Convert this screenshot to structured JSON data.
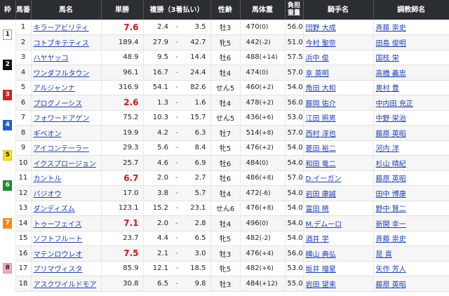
{
  "headers": {
    "waku": "枠",
    "umaban": "馬番",
    "name": "馬名",
    "odds": "単勝",
    "place": "複勝（3着払い）",
    "sexage": "性齢",
    "weight": "馬体重",
    "kinryo": "負担\n重量",
    "jockey": "騎手名",
    "trainer": "調教師名"
  },
  "waku_groups": [
    {
      "label": "1",
      "bg": "#ffffff",
      "fg": "#222222",
      "border": "#999999",
      "rows": 2
    },
    {
      "label": "2",
      "bg": "#111111",
      "fg": "#ffffff",
      "border": "#111111",
      "rows": 2
    },
    {
      "label": "3",
      "bg": "#d32020",
      "fg": "#ffffff",
      "border": "#d32020",
      "rows": 2
    },
    {
      "label": "4",
      "bg": "#1e5fd0",
      "fg": "#ffffff",
      "border": "#1e5fd0",
      "rows": 2
    },
    {
      "label": "5",
      "bg": "#f5e11a",
      "fg": "#222222",
      "border": "#e0c800",
      "rows": 2
    },
    {
      "label": "6",
      "bg": "#1e8a2e",
      "fg": "#ffffff",
      "border": "#1e8a2e",
      "rows": 2
    },
    {
      "label": "7",
      "bg": "#f08a1c",
      "fg": "#ffffff",
      "border": "#f08a1c",
      "rows": 3
    },
    {
      "label": "8",
      "bg": "#f5a8c0",
      "fg": "#222222",
      "border": "#e890ab",
      "rows": 3
    }
  ],
  "horses": [
    {
      "num": "1",
      "name": "キラーアビリティ",
      "odds": "7.6",
      "fav": true,
      "p1": "2.4",
      "p2": "3.5",
      "sexage": "牡3",
      "weight": "470",
      "diff": "(0)",
      "kinryo": "56.0",
      "jockey": "団野 大成",
      "trainer": "斉藤 崇史"
    },
    {
      "num": "2",
      "name": "コトブキテティス",
      "odds": "189.4",
      "fav": false,
      "p1": "27.9",
      "p2": "42.7",
      "sexage": "牝5",
      "weight": "442",
      "diff": "(-2)",
      "kinryo": "51.0",
      "jockey": "今村 聖奈",
      "trainer": "田島 俊明"
    },
    {
      "num": "3",
      "name": "ハヤヤッコ",
      "odds": "48.9",
      "fav": false,
      "p1": "9.5",
      "p2": "14.4",
      "sexage": "牡6",
      "weight": "488",
      "diff": "(+14)",
      "kinryo": "57.5",
      "jockey": "浜中 俊",
      "trainer": "国枝 栄"
    },
    {
      "num": "4",
      "name": "ワンダフルタウン",
      "odds": "96.1",
      "fav": false,
      "p1": "16.7",
      "p2": "24.4",
      "sexage": "牡4",
      "weight": "474",
      "diff": "(0)",
      "kinryo": "57.0",
      "jockey": "幸 英明",
      "trainer": "高橋 義忠"
    },
    {
      "num": "5",
      "name": "アルジャンナ",
      "odds": "316.9",
      "fav": false,
      "p1": "54.1",
      "p2": "82.6",
      "sexage": "せん5",
      "weight": "460",
      "diff": "(+2)",
      "kinryo": "54.0",
      "jockey": "角田 大和",
      "trainer": "奥村 豊"
    },
    {
      "num": "6",
      "name": "プログノーシス",
      "odds": "2.6",
      "fav": true,
      "p1": "1.3",
      "p2": "1.6",
      "sexage": "牡4",
      "weight": "478",
      "diff": "(+2)",
      "kinryo": "56.0",
      "jockey": "藤岡 佑介",
      "trainer": "中内田 充正"
    },
    {
      "num": "7",
      "name": "フォワードアゲン",
      "odds": "75.2",
      "fav": false,
      "p1": "10.3",
      "p2": "15.7",
      "sexage": "せん5",
      "weight": "436",
      "diff": "(+6)",
      "kinryo": "53.0",
      "jockey": "江田 照男",
      "trainer": "中野 栄治"
    },
    {
      "num": "8",
      "name": "ギベオン",
      "odds": "19.9",
      "fav": false,
      "p1": "4.2",
      "p2": "6.3",
      "sexage": "牡7",
      "weight": "514",
      "diff": "(+8)",
      "kinryo": "57.0",
      "jockey": "西村 淳也",
      "trainer": "藤原 英昭"
    },
    {
      "num": "9",
      "name": "アイコンテーラー",
      "odds": "29.3",
      "fav": false,
      "p1": "5.6",
      "p2": "8.4",
      "sexage": "牝5",
      "weight": "476",
      "diff": "(+2)",
      "kinryo": "54.0",
      "jockey": "菱田 裕二",
      "trainer": "河内 洋"
    },
    {
      "num": "10",
      "name": "イクスプロージョン",
      "odds": "25.7",
      "fav": false,
      "p1": "4.6",
      "p2": "6.9",
      "sexage": "牡6",
      "weight": "484",
      "diff": "(0)",
      "kinryo": "54.0",
      "jockey": "和田 竜二",
      "trainer": "杉山 晴紀"
    },
    {
      "num": "11",
      "name": "カントル",
      "odds": "6.7",
      "fav": true,
      "p1": "2.0",
      "p2": "2.7",
      "sexage": "牡6",
      "weight": "486",
      "diff": "(+8)",
      "kinryo": "57.0",
      "jockey": "D.イーガン",
      "trainer": "藤原 英昭"
    },
    {
      "num": "12",
      "name": "バジオウ",
      "odds": "17.0",
      "fav": false,
      "p1": "3.8",
      "p2": "5.7",
      "sexage": "牡4",
      "weight": "472",
      "diff": "(-6)",
      "kinryo": "54.0",
      "jockey": "岩田 康誠",
      "trainer": "田中 博康"
    },
    {
      "num": "13",
      "name": "ダンディズム",
      "odds": "123.1",
      "fav": false,
      "p1": "15.2",
      "p2": "23.1",
      "sexage": "せん6",
      "weight": "476",
      "diff": "(+8)",
      "kinryo": "54.0",
      "jockey": "富田 暁",
      "trainer": "野中 賢二"
    },
    {
      "num": "14",
      "name": "トゥーフェイス",
      "odds": "7.1",
      "fav": true,
      "p1": "2.0",
      "p2": "2.8",
      "sexage": "牡4",
      "weight": "496",
      "diff": "(0)",
      "kinryo": "54.0",
      "jockey": "M.デムーロ",
      "trainer": "新開 幸一"
    },
    {
      "num": "15",
      "name": "ソフトフルート",
      "odds": "23.7",
      "fav": false,
      "p1": "4.4",
      "p2": "6.5",
      "sexage": "牝5",
      "weight": "482",
      "diff": "(-2)",
      "kinryo": "54.0",
      "jockey": "酒井 学",
      "trainer": "斉藤 崇史"
    },
    {
      "num": "16",
      "name": "マテンロウレオ",
      "odds": "7.5",
      "fav": true,
      "p1": "2.1",
      "p2": "3.0",
      "sexage": "牡3",
      "weight": "476",
      "diff": "(+4)",
      "kinryo": "56.0",
      "jockey": "横山 典弘",
      "trainer": "昆 貢"
    },
    {
      "num": "17",
      "name": "プリマヴィスタ",
      "odds": "85.9",
      "fav": false,
      "p1": "12.1",
      "p2": "18.5",
      "sexage": "牝5",
      "weight": "482",
      "diff": "(+6)",
      "kinryo": "53.0",
      "jockey": "坂井 瑠星",
      "trainer": "矢作 芳人"
    },
    {
      "num": "18",
      "name": "アスクワイルドモア",
      "odds": "30.8",
      "fav": false,
      "p1": "6.5",
      "p2": "9.8",
      "sexage": "牡3",
      "weight": "484",
      "diff": "(+12)",
      "kinryo": "55.0",
      "jockey": "岩田 望来",
      "trainer": "藤原 英昭"
    }
  ]
}
